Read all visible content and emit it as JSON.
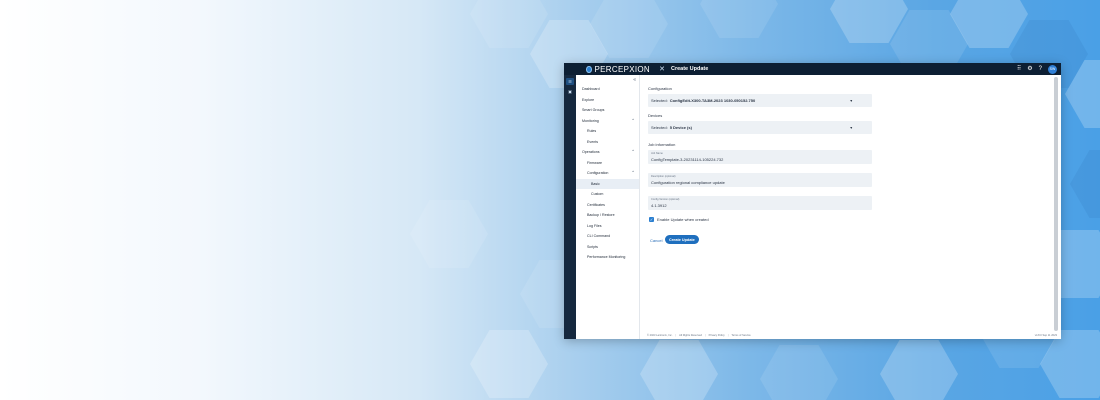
{
  "app": {
    "brand_small": "",
    "brand": "PERCEPXION",
    "close_icon": "close-icon",
    "title": "Create Update",
    "avatar_initials": "SW"
  },
  "sidebar": {
    "collapse_label": "«",
    "items": [
      {
        "label": "Dashboard"
      },
      {
        "label": "Explore"
      },
      {
        "label": "Smart Groups"
      },
      {
        "label": "Monitoring",
        "chevron": "⌃"
      },
      {
        "label": "Rules"
      },
      {
        "label": "Events"
      },
      {
        "label": "Operations",
        "chevron": "⌃"
      },
      {
        "label": "Firmware"
      },
      {
        "label": "Configuration",
        "chevron": "⌃"
      },
      {
        "label": "Basic"
      },
      {
        "label": "Custom"
      },
      {
        "label": "Certificates"
      },
      {
        "label": "Backup / Restore"
      },
      {
        "label": "Log Files"
      },
      {
        "label": "CLI Command"
      },
      {
        "label": "Scripts"
      },
      {
        "label": "Performance Monitoring"
      }
    ]
  },
  "form": {
    "configuration_label": "Configuration",
    "configuration_prefix": "Selected:",
    "configuration_value": "ConfigEdit-X300-TA3M-2023 1030-050152.750",
    "devices_label": "Devices",
    "devices_prefix": "Selected:",
    "devices_value": "5 Device (s)",
    "job_info_label": "Job information",
    "job_name_label": "Job Name",
    "job_name_value": "ConfigTemplate-3-20231114-105224.732",
    "description_label": "Description (optional)",
    "description_value": "Configuration regional compliance update",
    "config_version_label": "Config Version (optional)",
    "config_version_value": "4.1.3912",
    "checkbox_label": "Enable Update when created",
    "cancel_label": "Cancel",
    "create_label": "Create Update"
  },
  "footer": {
    "copyright": "© 2023 Lantronix, Inc.",
    "rights": "All Rights Reserved",
    "privacy": "Privacy Policy",
    "terms": "Terms of Service",
    "version": "v4.8.0 Sep 11 2023"
  },
  "colors": {
    "topbar": "#0d1f33",
    "accent": "#1f6fbe"
  }
}
